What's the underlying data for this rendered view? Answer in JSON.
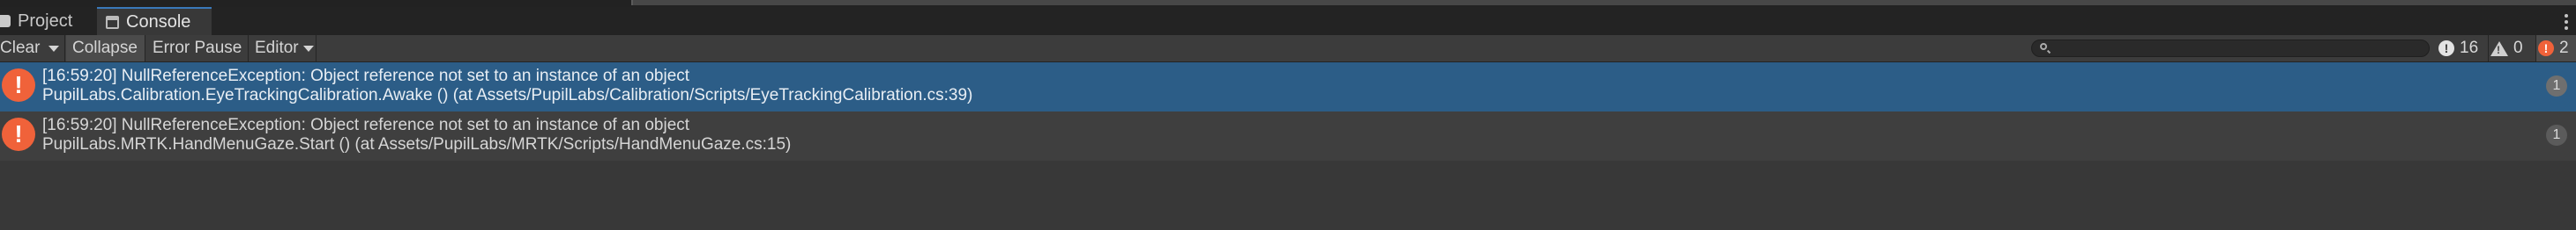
{
  "tabs": {
    "project_label": "Project",
    "console_label": "Console"
  },
  "toolbar": {
    "clear_label": "Clear",
    "collapse_label": "Collapse",
    "error_pause_label": "Error Pause",
    "editor_label": "Editor",
    "search_value": "",
    "info_count": "16",
    "warning_count": "0",
    "error_count": "2"
  },
  "logs": [
    {
      "line1": "[16:59:20] NullReferenceException: Object reference not set to an instance of an object",
      "line2": "PupilLabs.Calibration.EyeTrackingCalibration.Awake () (at Assets/PupilLabs/Calibration/Scripts/EyeTrackingCalibration.cs:39)",
      "count": "1",
      "selected": true
    },
    {
      "line1": "[16:59:20] NullReferenceException: Object reference not set to an instance of an object",
      "line2": "PupilLabs.MRTK.HandMenuGaze.Start () (at Assets/PupilLabs/MRTK/Scripts/HandMenuGaze.cs:15)",
      "count": "1",
      "selected": false
    }
  ],
  "icons": {
    "error": "error-icon",
    "warning": "warning-icon",
    "info": "info-icon"
  },
  "colors": {
    "selected_row": "#2c5d87",
    "error_red": "#f0623a",
    "accent_tab": "#3a79bb"
  }
}
